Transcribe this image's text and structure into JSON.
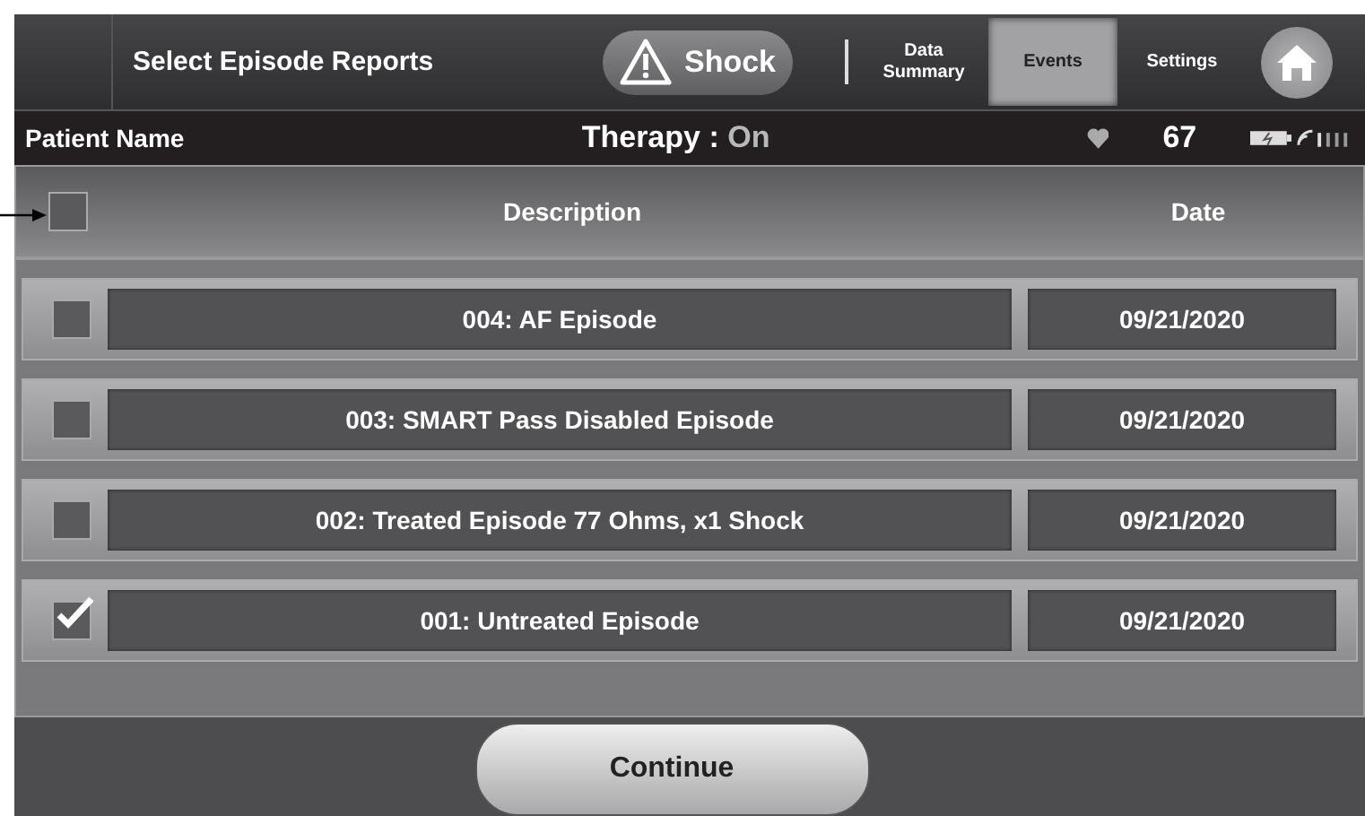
{
  "header": {
    "title": "Select Episode Reports",
    "shock_button": "Shock",
    "tabs": [
      {
        "label": "Data\nSummary",
        "selected": false
      },
      {
        "label": "Events",
        "selected": true
      },
      {
        "label": "Settings",
        "selected": false
      }
    ]
  },
  "status_bar": {
    "patient": "Patient Name",
    "therapy_label": "Therapy :",
    "therapy_value": "On",
    "heart_rate": "67"
  },
  "table": {
    "select_all_checked": false,
    "columns": [
      "Description",
      "Date"
    ],
    "rows": [
      {
        "description": "004: AF Episode",
        "date": "09/21/2020",
        "checked": false
      },
      {
        "description": "003: SMART Pass Disabled Episode",
        "date": "09/21/2020",
        "checked": false
      },
      {
        "description": "002: Treated Episode 77 Ohms, x1 Shock",
        "date": "09/21/2020",
        "checked": false
      },
      {
        "description": "001: Untreated Episode",
        "date": "09/21/2020",
        "checked": true
      }
    ]
  },
  "continue_button": "Continue"
}
